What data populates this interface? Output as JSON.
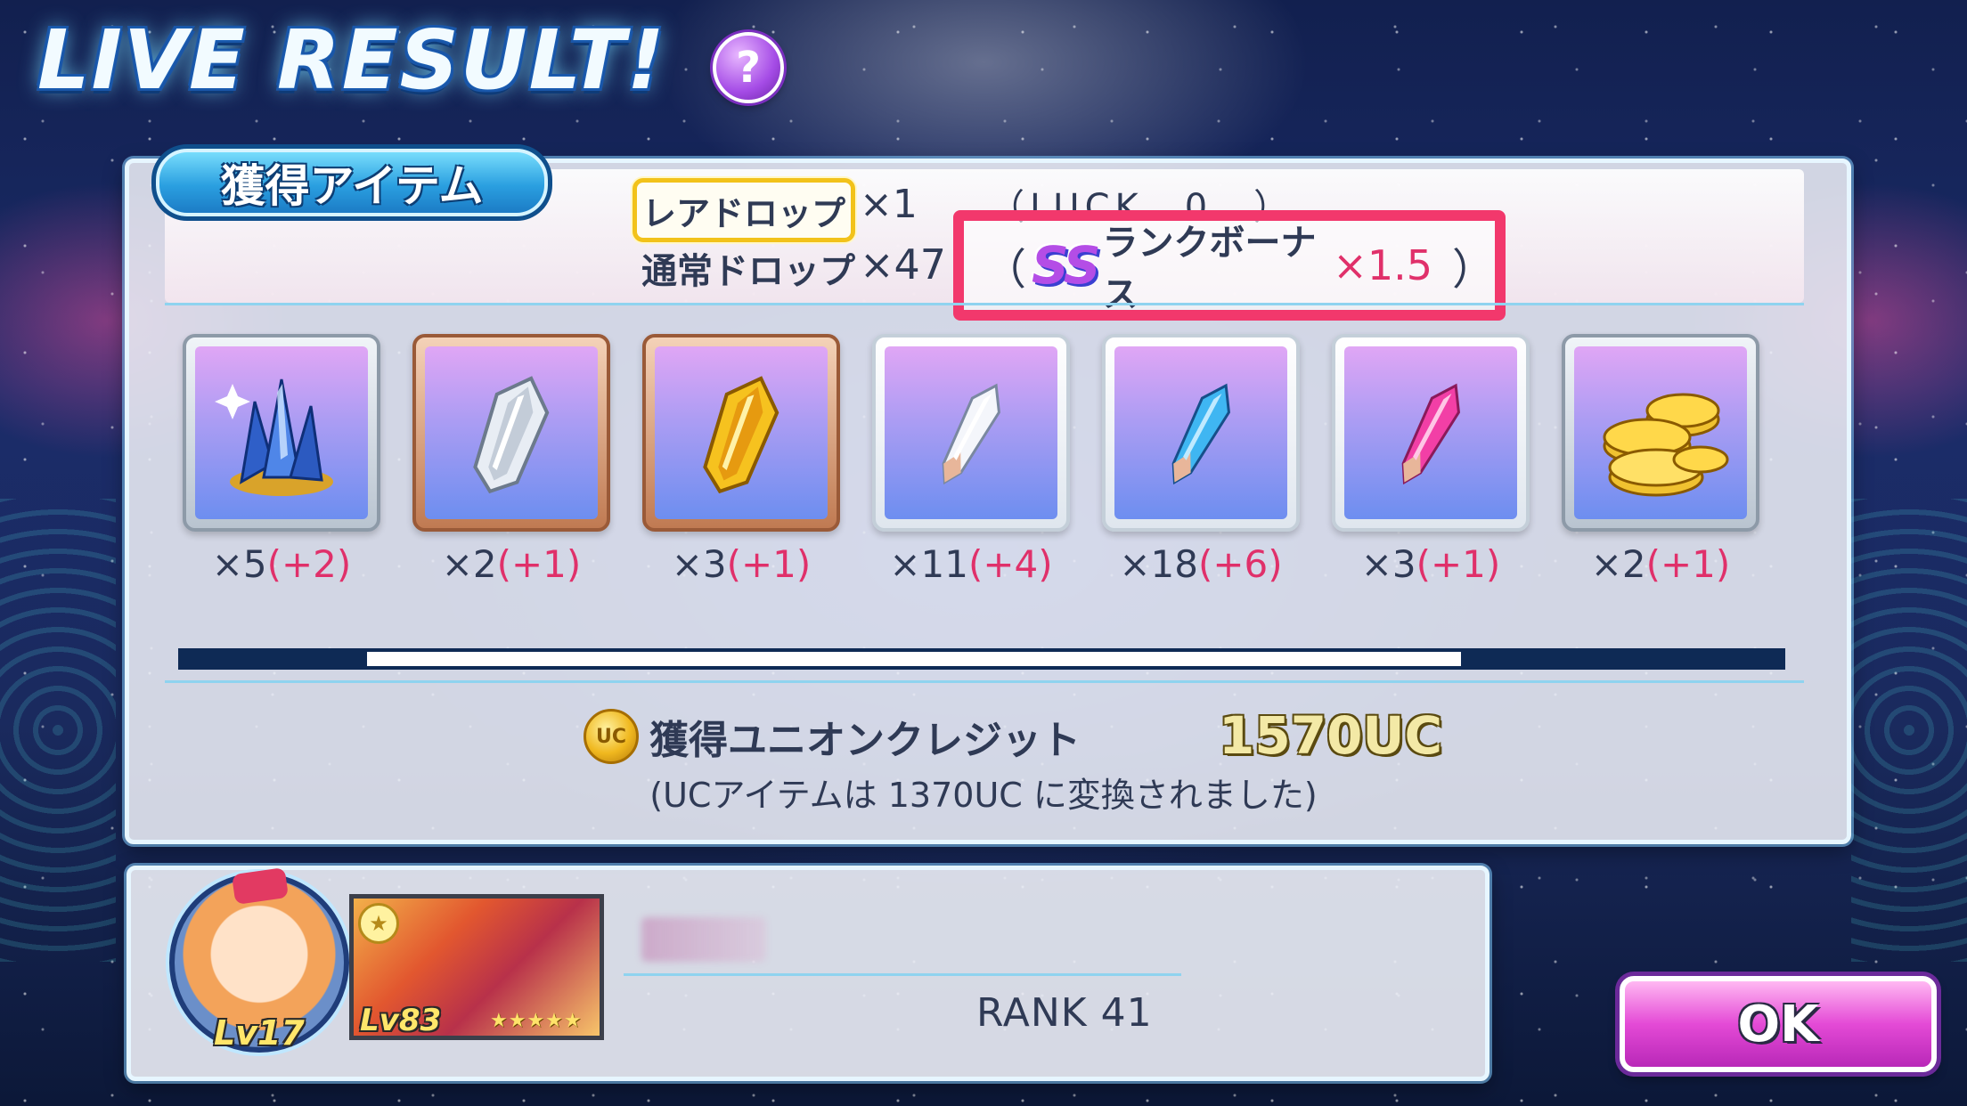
{
  "header": {
    "title": "LIVE RESULT!",
    "help_icon": "question-mark-icon",
    "help_label": "?"
  },
  "items_panel": {
    "tab_label": "獲得アイテム",
    "rare_drop": {
      "label": "レアドロップ",
      "multiplier": "×1",
      "luck_label": "（LUCK　0　）"
    },
    "normal_drop": {
      "label": "通常ドロップ",
      "multiplier": "×47"
    },
    "rank_bonus": {
      "open_paren": "（",
      "rank": "SS",
      "label": "ランクボーナス",
      "multiplier": "×1.5",
      "close_paren": "）"
    },
    "items": [
      {
        "icon": "blue-crystal-cluster-icon",
        "frame": "silver",
        "count": "×5",
        "bonus": "(+2)"
      },
      {
        "icon": "clear-gem-icon",
        "frame": "bronze",
        "count": "×2",
        "bonus": "(+1)"
      },
      {
        "icon": "gold-gem-icon",
        "frame": "bronze",
        "count": "×3",
        "bonus": "(+1)"
      },
      {
        "icon": "white-shard-icon",
        "frame": "white",
        "count": "×11",
        "bonus": "(+4)"
      },
      {
        "icon": "blue-shard-icon",
        "frame": "white",
        "count": "×18",
        "bonus": "(+6)"
      },
      {
        "icon": "pink-shard-icon",
        "frame": "white",
        "count": "×3",
        "bonus": "(+1)"
      },
      {
        "icon": "gold-coins-icon",
        "frame": "silver",
        "count": "×2",
        "bonus": "(+1)"
      }
    ],
    "union_credit": {
      "icon": "uc-coin-icon",
      "coin_label": "UC",
      "label": "獲得ユニオンクレジット",
      "value": "1570UC",
      "note": "(UCアイテムは 1370UC に変換されました)"
    }
  },
  "player": {
    "avatar_icon": "character-avatar-icon",
    "level": "Lv17",
    "card_icon": "member-card-thumbnail",
    "card_level": "Lv83",
    "card_stars": "★★★★★",
    "rank": "RANK 41"
  },
  "actions": {
    "ok_label": "OK"
  },
  "colors": {
    "bonus_red": "#e0306a",
    "highlight_box": "#f2386c",
    "ok_button": "#e44ad6",
    "tab_blue": "#2a9fe0",
    "rare_gold": "#f2c21a"
  }
}
